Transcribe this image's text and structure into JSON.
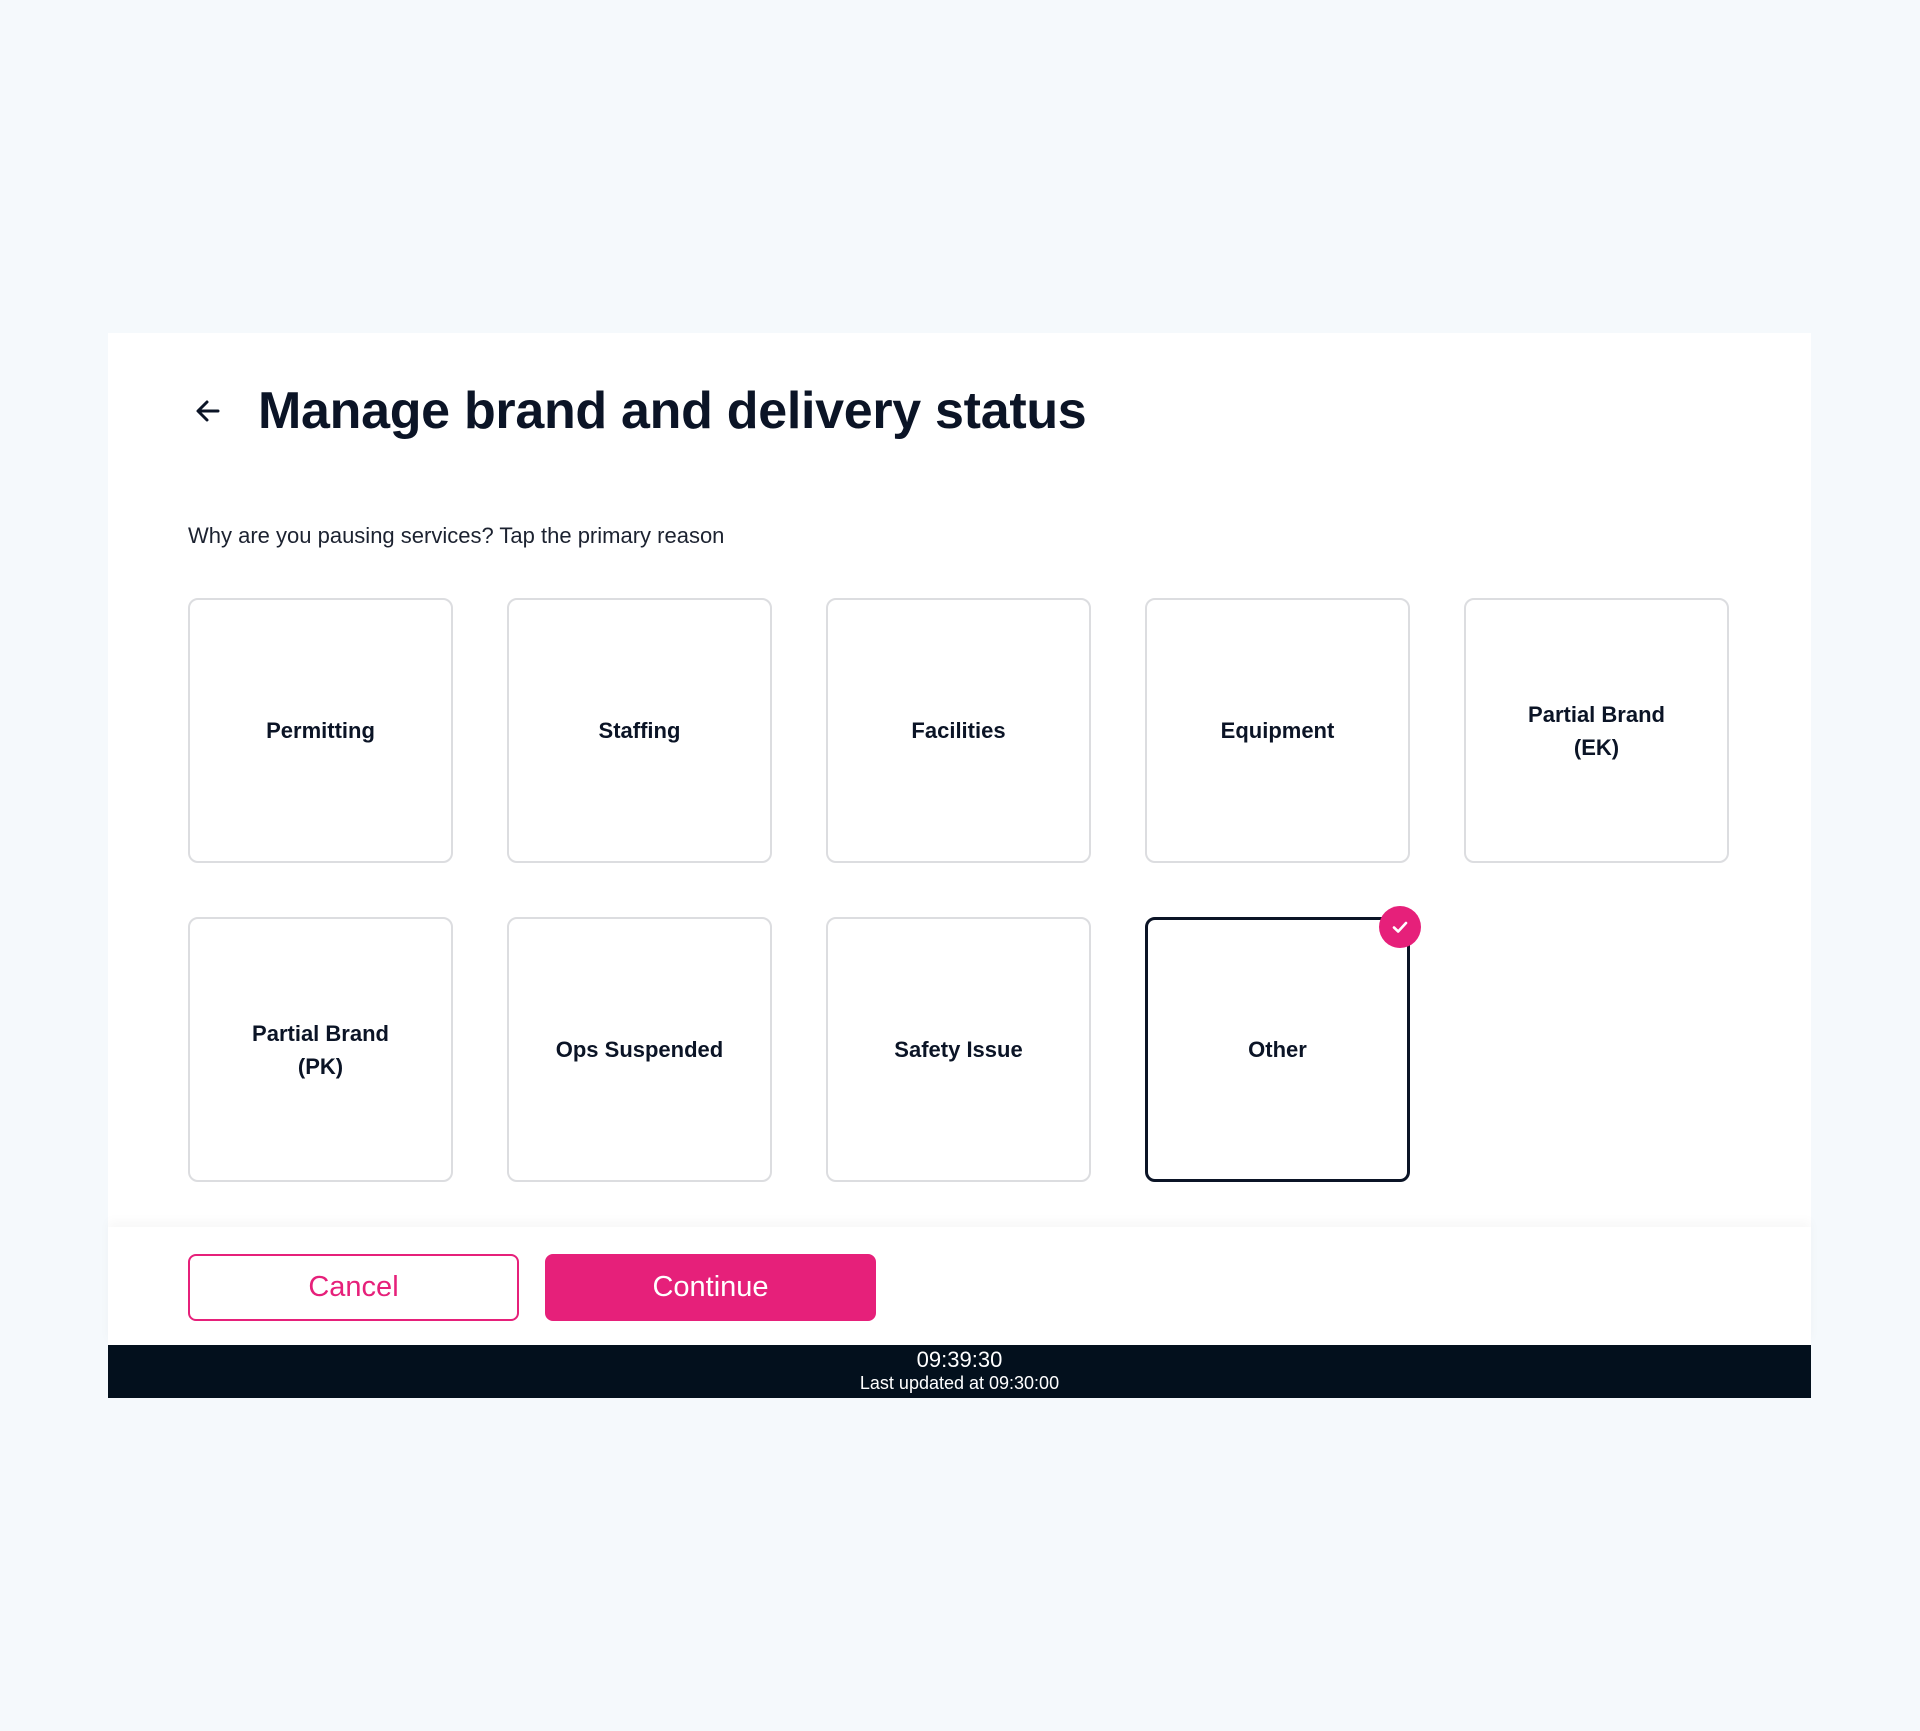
{
  "header": {
    "title": "Manage brand and delivery status",
    "back_icon": "arrow-left-icon"
  },
  "prompt": "Why are you pausing services? Tap the primary reason",
  "reasons": [
    {
      "label": "Permitting",
      "selected": false
    },
    {
      "label": "Staffing",
      "selected": false
    },
    {
      "label": "Facilities",
      "selected": false
    },
    {
      "label": "Equipment",
      "selected": false
    },
    {
      "label": "Partial Brand (EK)",
      "selected": false
    },
    {
      "label": "Partial Brand (PK)",
      "selected": false
    },
    {
      "label": "Ops Suspended",
      "selected": false
    },
    {
      "label": "Safety Issue",
      "selected": false
    },
    {
      "label": "Other",
      "selected": true
    }
  ],
  "footer": {
    "cancel_label": "Cancel",
    "continue_label": "Continue"
  },
  "status_bar": {
    "time": "09:39:30",
    "last_updated": "Last updated at 09:30:00"
  },
  "colors": {
    "accent": "#e6207a",
    "text_primary": "#0b1426",
    "status_bar_bg": "#03101d",
    "page_bg": "#f5f9fc",
    "tile_border": "#dcdde0"
  }
}
